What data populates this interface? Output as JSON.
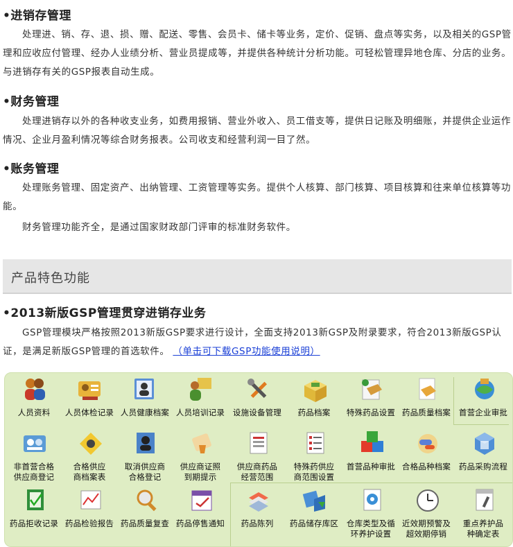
{
  "sections": [
    {
      "title": "•进销存管理",
      "paragraphs": [
        "处理进、销、存、退、损、赠、配送、零售、会员卡、储卡等业务，定价、促销、盘点等实务，以及相关的GSP管理和应收应付管理、经办人业绩分析、营业员提成等，并提供各种统计分析功能。可轻松管理异地仓库、分店的业务。与进销存有关的GSP报表自动生成。"
      ]
    },
    {
      "title": "•财务管理",
      "paragraphs": [
        "处理进销存以外的各种收支业务，如费用报销、营业外收入、员工借支等，提供日记账及明细账，并提供企业运作情况、企业月盈利情况等综合财务报表。公司收支和经营利润一目了然。"
      ]
    },
    {
      "title": "•账务管理",
      "paragraphs": [
        "处理账务管理、固定资产、出纳管理、工资管理等实务。提供个人核算、部门核算、项目核算和往来单位核算等功能。",
        "财务管理功能齐全，是通过国家财政部门评审的标准财务软件。"
      ]
    }
  ],
  "banner": {
    "title": "产品特色功能"
  },
  "gsp": {
    "title": "•2013新版GSP管理贯穿进销存业务",
    "text": "GSP管理模块严格按照2013新版GSP要求进行设计，全面支持2013新GSP及附录要求，符合2013新版GSP认证，是满足新版GSP管理的首选软件。",
    "link": "（单击可下载GSP功能使用说明）"
  },
  "features": [
    [
      {
        "label": "人员资料",
        "icon": "people-icon"
      },
      {
        "label": "人员体检记录",
        "icon": "id-card-icon"
      },
      {
        "label": "人员健康档案",
        "icon": "person-folder-icon"
      },
      {
        "label": "人员培训记录",
        "icon": "presenter-icon"
      },
      {
        "label": "设施设备管理",
        "icon": "tools-icon"
      },
      {
        "label": "药品档案",
        "icon": "medicine-box-icon"
      },
      {
        "label": "特殊药品设置",
        "icon": "special-box-icon"
      },
      {
        "label": "药品质量档案",
        "icon": "quality-box-icon"
      },
      {
        "label": "首营企业审批",
        "icon": "globe-building-icon"
      }
    ],
    [
      {
        "label": "非首营合格\n供应商登记",
        "icon": "supplier-group-icon"
      },
      {
        "label": "合格供应\n商档案表",
        "icon": "supplier-cards-icon"
      },
      {
        "label": "取消供应商\n合格登记",
        "icon": "cancel-supplier-icon"
      },
      {
        "label": "供应商证照\n到期提示",
        "icon": "license-scroll-icon"
      },
      {
        "label": "供应商药品\n经营范围",
        "icon": "document-list-icon"
      },
      {
        "label": "特殊药供应\n商范围设置",
        "icon": "checklist-icon"
      },
      {
        "label": "首营品种审批",
        "icon": "blocks-icon"
      },
      {
        "label": "合格品种档案",
        "icon": "pills-icon"
      },
      {
        "label": "药品采购流程",
        "icon": "purchase-flow-icon"
      }
    ],
    [
      {
        "label": "药品拒收记录",
        "icon": "reject-record-icon"
      },
      {
        "label": "药品检验报告",
        "icon": "report-chart-icon"
      },
      {
        "label": "药品质量复查",
        "icon": "magnifier-icon"
      },
      {
        "label": "药品停售通知",
        "icon": "calendar-icon"
      },
      {
        "label": "药品陈列",
        "icon": "shelf-icon"
      },
      {
        "label": "药品储存库区",
        "icon": "warehouse-icon"
      },
      {
        "label": "仓库类型及循\n环养护设置",
        "icon": "gear-doc-icon"
      },
      {
        "label": "近效期预警及\n超效期停销",
        "icon": "clock-icon"
      },
      {
        "label": "重点养护品\n种确定表",
        "icon": "maintenance-doc-icon"
      }
    ]
  ]
}
